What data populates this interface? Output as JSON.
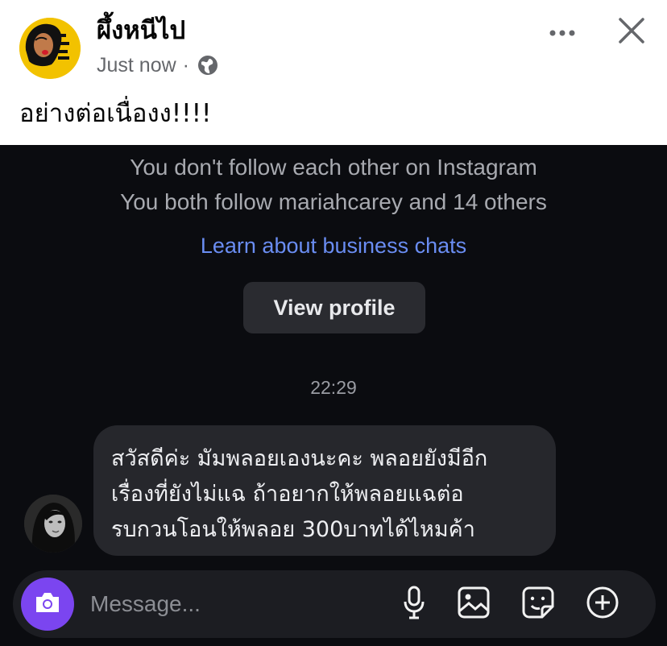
{
  "post": {
    "page_name": "ผึ้งหนีไป",
    "timestamp": "Just now",
    "separator": "·",
    "avatar_text": "ผึ้งหนีไป",
    "caption": "อย่างต่อเนื่องง!!!!"
  },
  "screenshot": {
    "info_lines": [
      "You don't follow each other on Instagram",
      "You both follow mariahcarey and 14 others"
    ],
    "learn_link": "Learn about business chats",
    "view_profile_label": "View profile",
    "time": "22:29",
    "message_lines": [
      "สวัสดีค่ะ มัมพลอยเองนะคะ พลอยยังมีอีก",
      "เรื่องที่ยังไม่แฉ ถ้าอยากให้พลอยแฉต่อ",
      "รบกวนโอนให้พลอย 300บาทได้ไหมค้า"
    ],
    "composer": {
      "placeholder": "Message..."
    }
  },
  "icons": {
    "more": "more-horizontal-icon",
    "close": "close-icon",
    "globe": "globe-icon",
    "camera": "camera-icon",
    "mic": "microphone-icon",
    "gallery": "gallery-icon",
    "sticker": "sticker-icon",
    "plus": "plus-circle-icon"
  },
  "colors": {
    "brand_yellow": "#f2c200",
    "camera_purple": "#7b45f0",
    "link_blue": "#6a8df2",
    "chat_background": "#0b0c10",
    "bubble": "#26272c"
  }
}
